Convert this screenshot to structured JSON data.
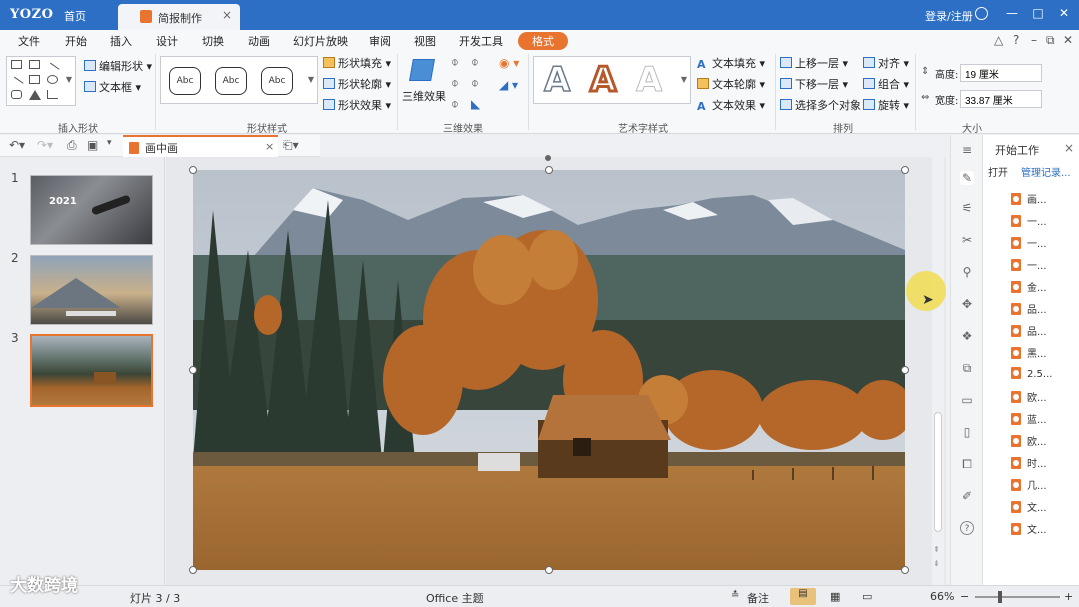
{
  "title_bar": {
    "logo": "YOZO",
    "home": "首页",
    "doc_tab": "简报制作",
    "login": "登录/注册",
    "window_buttons": [
      "—",
      "□",
      "✕"
    ]
  },
  "menu": {
    "items": [
      "文件",
      "开始",
      "插入",
      "设计",
      "切换",
      "动画",
      "幻灯片放映",
      "审阅",
      "视图",
      "开发工具",
      "格式"
    ],
    "active": "格式",
    "right_controls": [
      "△",
      "?",
      "–",
      "⧉",
      "✕"
    ]
  },
  "ribbon": {
    "insert_shapes": {
      "edit_shape": "编辑形状",
      "text_box": "文本框",
      "label": "插入形状"
    },
    "shape_styles": {
      "samples": [
        "Abc",
        "Abc",
        "Abc"
      ],
      "fill": "形状填充",
      "outline": "形状轮廓",
      "effects": "形状效果",
      "label": "形状样式"
    },
    "three_d": {
      "button": "三维效果",
      "label": "三维效果"
    },
    "art_styles": {
      "samples": [
        "A",
        "A",
        "A"
      ],
      "text_fill": "文本填充",
      "text_outline": "文本轮廓",
      "text_effect": "文本效果",
      "label": "艺术字样式"
    },
    "arrange": {
      "bring_forward": "上移一层",
      "send_backward": "下移一层",
      "select_objects": "选择多个对象",
      "align": "对齐",
      "group": "组合",
      "rotate": "旋转",
      "label": "排列"
    },
    "size": {
      "height_label": "高度:",
      "height_value": "19 厘米",
      "width_label": "宽度:",
      "width_value": "33.87 厘米",
      "label": "大小"
    }
  },
  "qat": {
    "doc_tab": "画中画"
  },
  "thumbnails": {
    "numbers": [
      "1",
      "2",
      "3"
    ],
    "selected": 3,
    "slide1_text": "2021"
  },
  "task_pane": {
    "title": "开始工作",
    "open": "打开",
    "manage": "管理记录...",
    "files": [
      "画...",
      "一...",
      "一...",
      "一...",
      "金...",
      "品...",
      "品...",
      "黑...",
      "2.5...",
      "欧...",
      "蓝...",
      "欧...",
      "时...",
      "几...",
      "文...",
      "文..."
    ]
  },
  "status": {
    "slide_info": "灯片 3 / 3",
    "theme": "Office 主题",
    "notes": "备注",
    "zoom": "66%"
  },
  "watermark": "大数跨境",
  "colors": {
    "title_blue": "#2d6fc4",
    "accent_orange": "#e8742f"
  }
}
